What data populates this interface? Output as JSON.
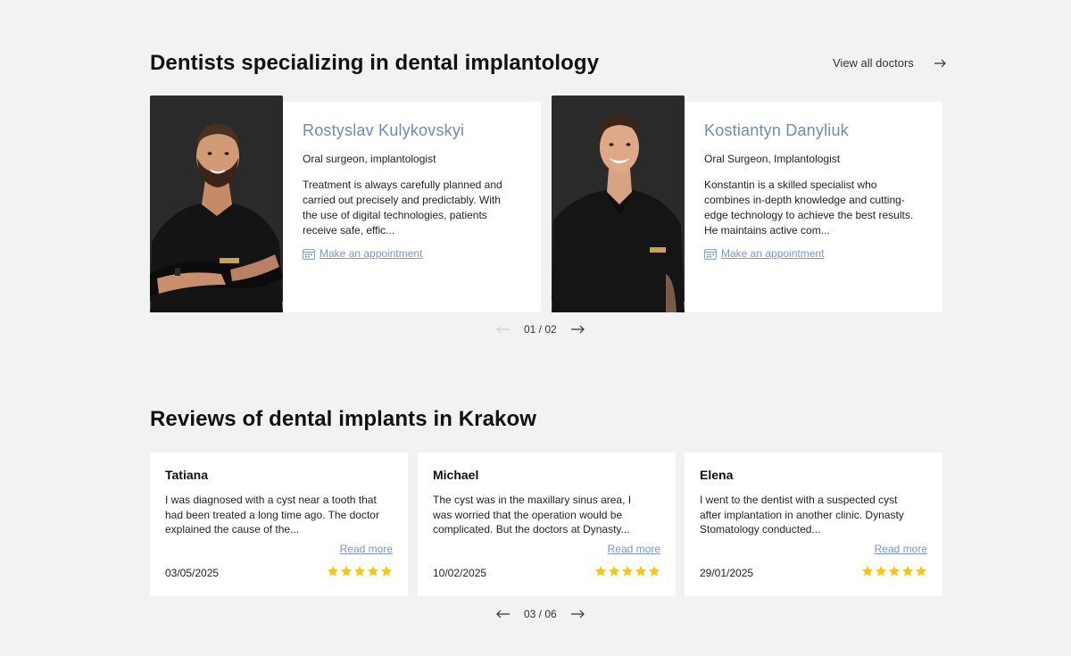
{
  "doctors_section": {
    "title": "Dentists specializing in dental implantology",
    "view_all": "View all doctors",
    "doctors": [
      {
        "name": "Rostyslav Kulykovskyi",
        "role": "Oral surgeon, implantologist",
        "description": "Treatment is always carefully planned and carried out precisely and predictably. With the use of digital technologies, patients receive safe, effic...",
        "appointment": "Make an appointment"
      },
      {
        "name": "Kostiantyn Danyliuk",
        "role": "Oral Surgeon, Implantologist",
        "description": "Konstantin is a skilled specialist who combines in-depth knowledge and cutting-edge technology to achieve the best results. He maintains active com...",
        "appointment": "Make an appointment"
      }
    ],
    "pager": "01 / 02"
  },
  "reviews_section": {
    "title": "Reviews of dental implants in Krakow",
    "reviews": [
      {
        "name": "Tatiana",
        "text": "I was diagnosed with a cyst near a tooth that had been treated a long time ago. The doctor explained the cause of the...",
        "read_more": "Read more",
        "date": "03/05/2025",
        "rating": 5
      },
      {
        "name": "Michael",
        "text": "The cyst was in the maxillary sinus area, I was worried that the operation would be complicated. But the doctors at Dynasty...",
        "read_more": "Read more",
        "date": "10/02/2025",
        "rating": 5
      },
      {
        "name": "Elena",
        "text": "I went to the dentist with a suspected cyst after implantation in another clinic. Dynasty Stomatology conducted...",
        "read_more": "Read more",
        "date": "29/01/2025",
        "rating": 5
      }
    ],
    "pager": "03 / 06"
  },
  "colors": {
    "background": "#f2f2f2",
    "accent_link": "#7b95c4",
    "doctor_name": "#6f8ab8",
    "star": "#f5c518",
    "photo_bg": "#2a2a2a"
  },
  "icons": [
    "arrow-right-icon",
    "arrow-left-icon",
    "calendar-icon",
    "star-icon"
  ]
}
